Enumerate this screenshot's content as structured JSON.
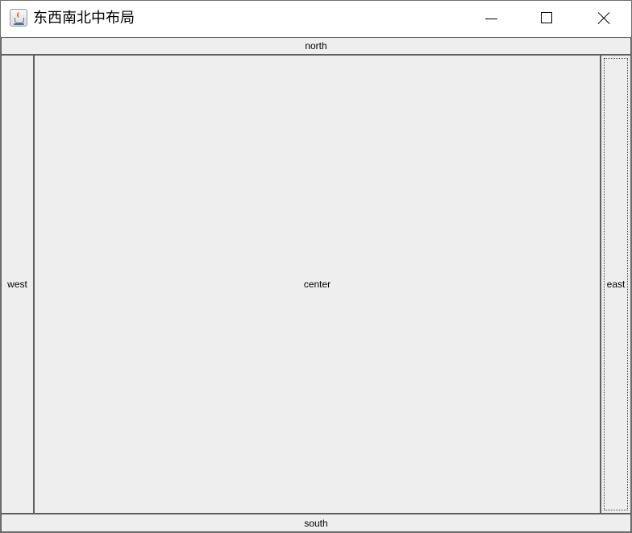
{
  "window": {
    "title": "东西南北中布局",
    "icon": "java-coffee-cup-icon"
  },
  "controls": {
    "minimize_icon": "minimize-icon",
    "maximize_icon": "maximize-icon",
    "close_icon": "close-icon"
  },
  "regions": {
    "north": "north",
    "west": "west",
    "center": "center",
    "east": "east",
    "south": "south"
  },
  "colors": {
    "panel_background": "#eeeeee",
    "titlebar_background": "#ffffff",
    "border": "#5f5f5f"
  }
}
